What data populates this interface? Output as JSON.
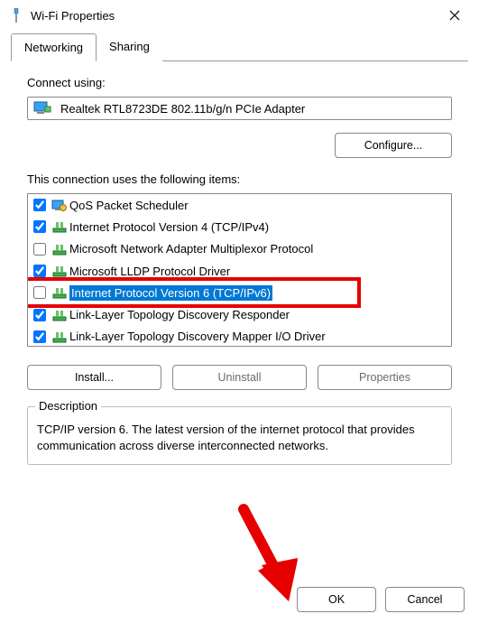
{
  "window": {
    "title": "Wi-Fi Properties"
  },
  "tabs": {
    "networking": "Networking",
    "sharing": "Sharing"
  },
  "connect_using_label": "Connect using:",
  "adapter_name": "Realtek RTL8723DE 802.11b/g/n PCIe Adapter",
  "configure_label": "Configure...",
  "items_label": "This connection uses the following items:",
  "items": [
    {
      "checked": true,
      "label": "QoS Packet Scheduler",
      "icon": "qos"
    },
    {
      "checked": true,
      "label": "Internet Protocol Version 4 (TCP/IPv4)",
      "icon": "proto"
    },
    {
      "checked": false,
      "label": "Microsoft Network Adapter Multiplexor Protocol",
      "icon": "proto"
    },
    {
      "checked": true,
      "label": "Microsoft LLDP Protocol Driver",
      "icon": "proto"
    },
    {
      "checked": false,
      "label": "Internet Protocol Version 6 (TCP/IPv6)",
      "icon": "proto",
      "highlighted": true
    },
    {
      "checked": true,
      "label": "Link-Layer Topology Discovery Responder",
      "icon": "proto"
    },
    {
      "checked": true,
      "label": "Link-Layer Topology Discovery Mapper I/O Driver",
      "icon": "proto"
    }
  ],
  "buttons": {
    "install": "Install...",
    "uninstall": "Uninstall",
    "properties": "Properties"
  },
  "description": {
    "legend": "Description",
    "text": "TCP/IP version 6. The latest version of the internet protocol that provides communication across diverse interconnected networks."
  },
  "footer": {
    "ok": "OK",
    "cancel": "Cancel"
  }
}
